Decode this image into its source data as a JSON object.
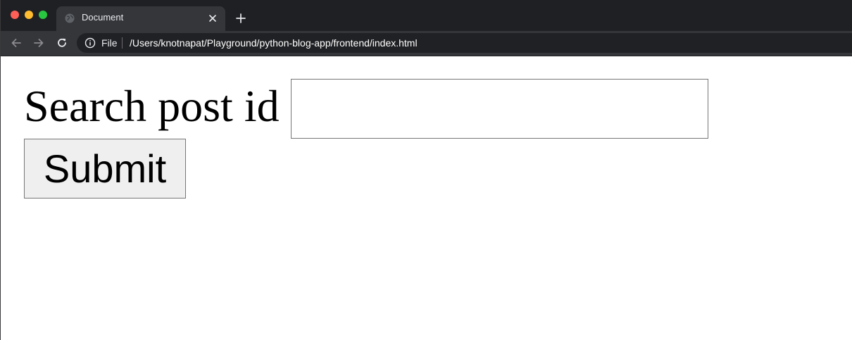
{
  "browser": {
    "tab": {
      "title": "Document"
    },
    "address_bar": {
      "scheme_label": "File",
      "url": "/Users/knotnapat/Playground/python-blog-app/frontend/index.html"
    },
    "colors": {
      "traffic_red": "#fe5f57",
      "traffic_yellow": "#febc2e",
      "traffic_green": "#28c840",
      "chrome_dark": "#1f2023",
      "toolbar": "#35363a"
    },
    "icons": [
      "globe-icon",
      "close-icon",
      "plus-icon",
      "back-arrow-icon",
      "forward-arrow-icon",
      "reload-icon",
      "info-icon"
    ]
  },
  "page": {
    "search_label": "Search post id",
    "search_input": {
      "value": "",
      "placeholder": ""
    },
    "submit_label": "Submit"
  }
}
